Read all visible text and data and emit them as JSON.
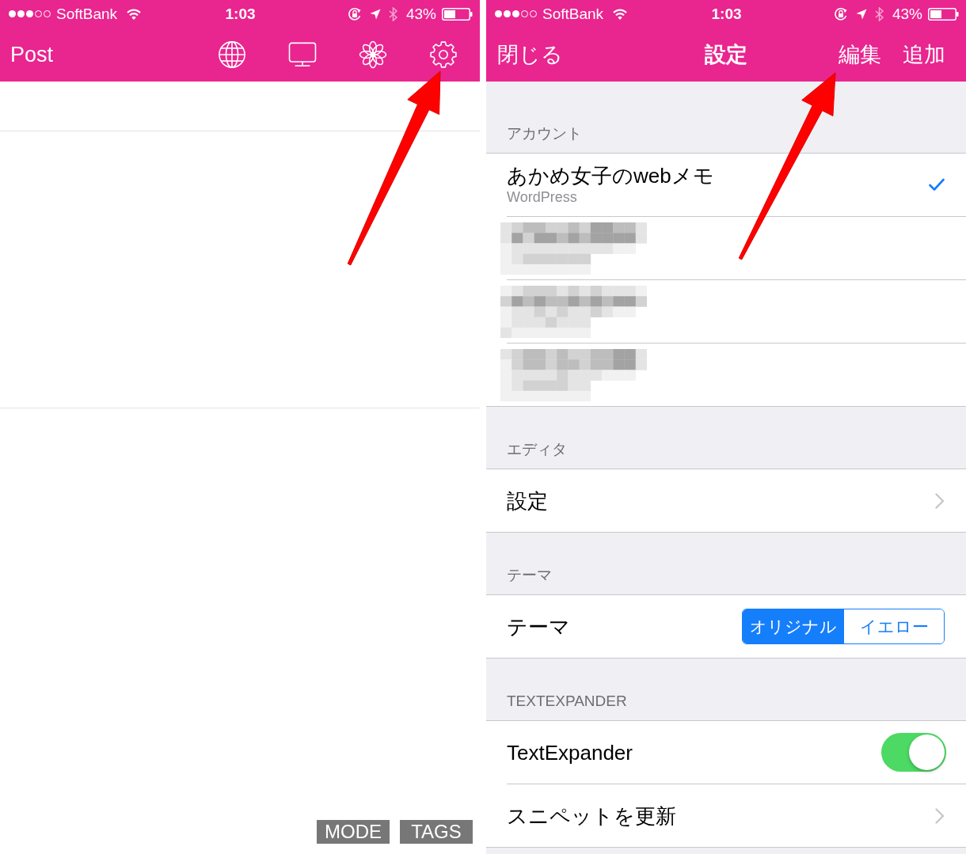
{
  "left_screen": {
    "status_bar": {
      "carrier": "SoftBank",
      "time": "1:03",
      "battery": "43%"
    },
    "nav_bar": {
      "title": "Post"
    },
    "bottom_buttons": [
      "MODE",
      "TAGS"
    ]
  },
  "right_screen": {
    "status_bar": {
      "carrier": "SoftBank",
      "time": "1:03",
      "battery": "43%"
    },
    "nav_bar": {
      "left_button": "閉じる",
      "title": "設定",
      "right_buttons": [
        "編集",
        "追加"
      ]
    },
    "sections": [
      {
        "header": "アカウント",
        "rows": [
          {
            "kind": "account",
            "title": "あかめ女子のwebメモ",
            "subtitle": "WordPress",
            "selected": true
          },
          {
            "kind": "redacted"
          },
          {
            "kind": "redacted"
          },
          {
            "kind": "redacted"
          }
        ]
      },
      {
        "header": "エディタ",
        "rows": [
          {
            "kind": "link",
            "title": "設定"
          }
        ]
      },
      {
        "header": "テーマ",
        "rows": [
          {
            "kind": "segmented",
            "title": "テーマ",
            "segments": [
              {
                "label": "オリジナル",
                "selected": true
              },
              {
                "label": "イエロー",
                "selected": false
              }
            ]
          }
        ]
      },
      {
        "header": "TEXTEXPANDER",
        "rows": [
          {
            "kind": "toggle",
            "title": "TextExpander",
            "on": true
          },
          {
            "kind": "link",
            "title": "スニペットを更新"
          }
        ]
      }
    ]
  }
}
